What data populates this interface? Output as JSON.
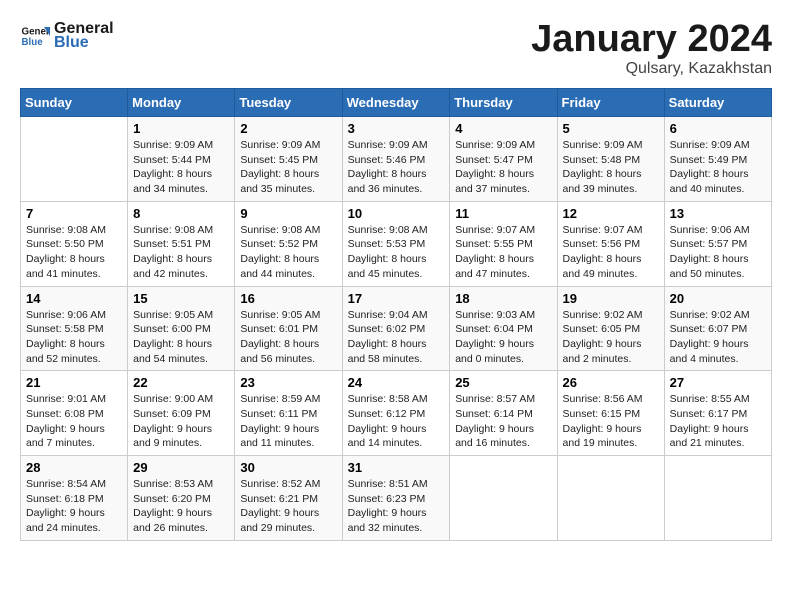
{
  "logo": {
    "line1": "General",
    "line2": "Blue"
  },
  "title": "January 2024",
  "subtitle": "Qulsary, Kazakhstan",
  "days_of_week": [
    "Sunday",
    "Monday",
    "Tuesday",
    "Wednesday",
    "Thursday",
    "Friday",
    "Saturday"
  ],
  "weeks": [
    [
      {
        "num": "",
        "info": ""
      },
      {
        "num": "1",
        "info": "Sunrise: 9:09 AM\nSunset: 5:44 PM\nDaylight: 8 hours\nand 34 minutes."
      },
      {
        "num": "2",
        "info": "Sunrise: 9:09 AM\nSunset: 5:45 PM\nDaylight: 8 hours\nand 35 minutes."
      },
      {
        "num": "3",
        "info": "Sunrise: 9:09 AM\nSunset: 5:46 PM\nDaylight: 8 hours\nand 36 minutes."
      },
      {
        "num": "4",
        "info": "Sunrise: 9:09 AM\nSunset: 5:47 PM\nDaylight: 8 hours\nand 37 minutes."
      },
      {
        "num": "5",
        "info": "Sunrise: 9:09 AM\nSunset: 5:48 PM\nDaylight: 8 hours\nand 39 minutes."
      },
      {
        "num": "6",
        "info": "Sunrise: 9:09 AM\nSunset: 5:49 PM\nDaylight: 8 hours\nand 40 minutes."
      }
    ],
    [
      {
        "num": "7",
        "info": "Sunrise: 9:08 AM\nSunset: 5:50 PM\nDaylight: 8 hours\nand 41 minutes."
      },
      {
        "num": "8",
        "info": "Sunrise: 9:08 AM\nSunset: 5:51 PM\nDaylight: 8 hours\nand 42 minutes."
      },
      {
        "num": "9",
        "info": "Sunrise: 9:08 AM\nSunset: 5:52 PM\nDaylight: 8 hours\nand 44 minutes."
      },
      {
        "num": "10",
        "info": "Sunrise: 9:08 AM\nSunset: 5:53 PM\nDaylight: 8 hours\nand 45 minutes."
      },
      {
        "num": "11",
        "info": "Sunrise: 9:07 AM\nSunset: 5:55 PM\nDaylight: 8 hours\nand 47 minutes."
      },
      {
        "num": "12",
        "info": "Sunrise: 9:07 AM\nSunset: 5:56 PM\nDaylight: 8 hours\nand 49 minutes."
      },
      {
        "num": "13",
        "info": "Sunrise: 9:06 AM\nSunset: 5:57 PM\nDaylight: 8 hours\nand 50 minutes."
      }
    ],
    [
      {
        "num": "14",
        "info": "Sunrise: 9:06 AM\nSunset: 5:58 PM\nDaylight: 8 hours\nand 52 minutes."
      },
      {
        "num": "15",
        "info": "Sunrise: 9:05 AM\nSunset: 6:00 PM\nDaylight: 8 hours\nand 54 minutes."
      },
      {
        "num": "16",
        "info": "Sunrise: 9:05 AM\nSunset: 6:01 PM\nDaylight: 8 hours\nand 56 minutes."
      },
      {
        "num": "17",
        "info": "Sunrise: 9:04 AM\nSunset: 6:02 PM\nDaylight: 8 hours\nand 58 minutes."
      },
      {
        "num": "18",
        "info": "Sunrise: 9:03 AM\nSunset: 6:04 PM\nDaylight: 9 hours\nand 0 minutes."
      },
      {
        "num": "19",
        "info": "Sunrise: 9:02 AM\nSunset: 6:05 PM\nDaylight: 9 hours\nand 2 minutes."
      },
      {
        "num": "20",
        "info": "Sunrise: 9:02 AM\nSunset: 6:07 PM\nDaylight: 9 hours\nand 4 minutes."
      }
    ],
    [
      {
        "num": "21",
        "info": "Sunrise: 9:01 AM\nSunset: 6:08 PM\nDaylight: 9 hours\nand 7 minutes."
      },
      {
        "num": "22",
        "info": "Sunrise: 9:00 AM\nSunset: 6:09 PM\nDaylight: 9 hours\nand 9 minutes."
      },
      {
        "num": "23",
        "info": "Sunrise: 8:59 AM\nSunset: 6:11 PM\nDaylight: 9 hours\nand 11 minutes."
      },
      {
        "num": "24",
        "info": "Sunrise: 8:58 AM\nSunset: 6:12 PM\nDaylight: 9 hours\nand 14 minutes."
      },
      {
        "num": "25",
        "info": "Sunrise: 8:57 AM\nSunset: 6:14 PM\nDaylight: 9 hours\nand 16 minutes."
      },
      {
        "num": "26",
        "info": "Sunrise: 8:56 AM\nSunset: 6:15 PM\nDaylight: 9 hours\nand 19 minutes."
      },
      {
        "num": "27",
        "info": "Sunrise: 8:55 AM\nSunset: 6:17 PM\nDaylight: 9 hours\nand 21 minutes."
      }
    ],
    [
      {
        "num": "28",
        "info": "Sunrise: 8:54 AM\nSunset: 6:18 PM\nDaylight: 9 hours\nand 24 minutes."
      },
      {
        "num": "29",
        "info": "Sunrise: 8:53 AM\nSunset: 6:20 PM\nDaylight: 9 hours\nand 26 minutes."
      },
      {
        "num": "30",
        "info": "Sunrise: 8:52 AM\nSunset: 6:21 PM\nDaylight: 9 hours\nand 29 minutes."
      },
      {
        "num": "31",
        "info": "Sunrise: 8:51 AM\nSunset: 6:23 PM\nDaylight: 9 hours\nand 32 minutes."
      },
      {
        "num": "",
        "info": ""
      },
      {
        "num": "",
        "info": ""
      },
      {
        "num": "",
        "info": ""
      }
    ]
  ]
}
